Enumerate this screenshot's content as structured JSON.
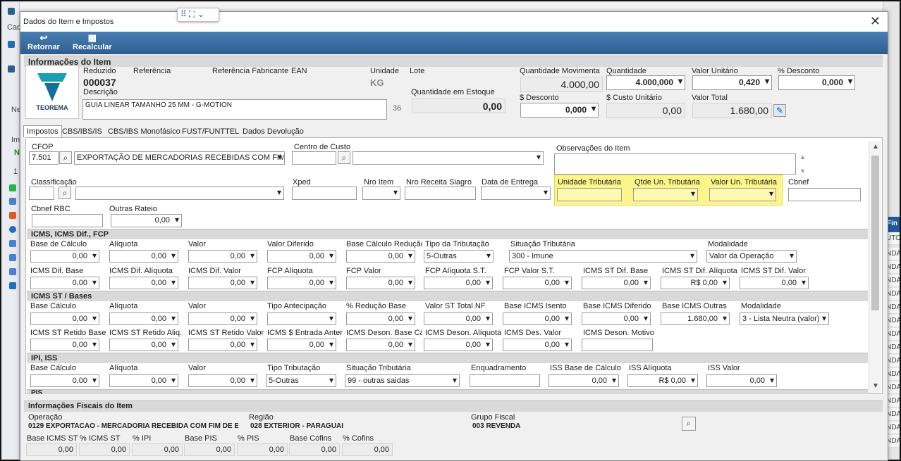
{
  "background": {
    "left_texts": [
      "Cad",
      "Ne",
      "Im",
      "N",
      "1"
    ],
    "right_header": "Fin",
    "right_cells": [
      "UTO",
      "NDA",
      "NDA",
      "NDA",
      "NDA",
      "NDA",
      "NDA",
      "NDA",
      "NDA",
      "NDA",
      "NDA",
      "NDA",
      "NDA",
      "NDA",
      "NDA",
      "NDA"
    ]
  },
  "dialog": {
    "title": "Dados do Item e Impostos"
  },
  "toolbar": {
    "retornar": "Retornar",
    "recalcular": "Recalcular"
  },
  "item_info": {
    "section_title": "Informações do Item",
    "logo_text": "TEOREMA",
    "reduzido_label": "Reduzido",
    "reduzido_value": "000037",
    "referencia_label": "Referência",
    "ref_fabricante_label": "Referência Fabricante",
    "ean_label": "EAN",
    "unidade_label": "Unidade",
    "unidade_value": "KG",
    "lote_label": "Lote",
    "descricao_label": "Descrição",
    "descricao_value": "GUIA LINEAR TAMANHO 25 MM - G-MOTION",
    "descricao_num": "36",
    "qtd_estoque_label": "Quantidade em Estoque",
    "qtd_estoque_value": "0,00",
    "qtd_movimenta_label": "Quantidade Movimenta",
    "qtd_movimenta_value": "4.000,00",
    "quantidade_label": "Quantidade",
    "quantidade_value": "4.000,000",
    "valor_unitario_label": "Valor Unitário",
    "valor_unitario_value": "0,420",
    "desconto_pct_label": "% Desconto",
    "desconto_pct_value": "0,000",
    "desconto_label": "$ Desconto",
    "desconto_value": "0,000",
    "custo_unitario_label": "$ Custo Unitário",
    "custo_unitario_value": "0,00",
    "valor_total_label": "Valor Total",
    "valor_total_value": "1.680,00"
  },
  "tabs": [
    "Impostos",
    "CBS/IBS/IS",
    "CBS/IBS Monofásico",
    "FUST/FUNTTEL",
    "Dados Devolução"
  ],
  "top_fields": {
    "cfop_label": "CFOP",
    "cfop_code": "7.501",
    "cfop_desc": "EXPORTAÇÃO DE MERCADORIAS RECEBIDAS COM FIM E",
    "centro_custo_label": "Centro de Custo",
    "obs_label": "Observações do Item",
    "classificacao_label": "Classificação",
    "xped_label": "Xped",
    "nro_item_label": "Nro Item",
    "nro_receita_label": "Nro Receita Siagro",
    "data_entrega_label": "Data de Entrega",
    "unidade_trib_label": "Unidade Tributária",
    "qtde_un_trib_label": "Qtde Un. Tributária",
    "valor_un_trib_label": "Valor Un. Tributária",
    "cbnef_label": "Cbnef",
    "cbnef_rbc_label": "Cbnef RBC",
    "outras_rateio_label": "Outras Rateio",
    "outras_rateio_value": "0,00"
  },
  "icms": {
    "title": "ICMS, ICMS Dif., FCP",
    "row1_labels": [
      "Base de Cálculo",
      "Alíquota",
      "Valor",
      "Valor Diferido",
      "Base Cálculo Redução",
      "Tipo da Tributação",
      "Situação Tributária",
      "Modalidade"
    ],
    "row1_values": [
      "0,00",
      "0,00",
      "0,00",
      "0,00",
      "0,00"
    ],
    "tipo_tributacao": "5-Outras",
    "situacao": "300 - Imune",
    "modalidade": "Valor da Operação",
    "row2_labels": [
      "ICMS Dif. Base",
      "ICMS Dif. Alíquota",
      "ICMS Dif. Valor",
      "FCP Alíquota",
      "FCP Valor",
      "FCP Alíquota S.T.",
      "FCP Valor S.T.",
      "ICMS ST Dif. Base",
      "ICMS ST Dif. Alíquota",
      "ICMS ST Dif. Valor"
    ],
    "row2_values": [
      "0,00",
      "0,00",
      "0,00",
      "0,00",
      "0,00",
      "0,00",
      "0,00",
      "0,00",
      "R$ 0,00",
      "0,00"
    ]
  },
  "icms_st": {
    "title": "ICMS ST / Bases",
    "row1_labels": [
      "Base Cálculo",
      "Alíquota",
      "Valor",
      "Tipo Antecipação",
      "% Redução Base",
      "Valor ST Total NF",
      "Base ICMS Isento",
      "Base ICMS Diferido",
      "Base ICMS Outras",
      "Modalidade"
    ],
    "row1_values": [
      "0,00",
      "0,00",
      "0,00",
      "",
      "0,00",
      "0,00",
      "0,00",
      "0,00",
      "1.680,00"
    ],
    "modalidade": "3 - Lista Neutra (valor)",
    "row2_labels": [
      "ICMS ST Retido Base",
      "ICMS ST Retido Aliq.",
      "ICMS ST Retido Valor",
      "ICMS $ Entrada Anter",
      "ICMS Deson. Base Cál",
      "ICMS Deson. Alíquota",
      "ICMS Des. Valor",
      "ICMS Deson. Motivo"
    ],
    "row2_values": [
      "0,00",
      "0,00",
      "0,00",
      "0,00",
      "0,00",
      "0,00",
      "0,00"
    ]
  },
  "ipi_iss": {
    "title": "IPI, ISS",
    "labels": [
      "Base Cálculo",
      "Alíquota",
      "Valor",
      "Tipo Tributação",
      "Situação Tributária",
      "Enquadramento",
      "ISS Base de Cálculo",
      "ISS Alíquota",
      "ISS Valor"
    ],
    "values": [
      "0,00",
      "0,00",
      "0,00"
    ],
    "tipo_tributacao": "5-Outras",
    "situacao": "99 - outras saidas",
    "iss_base": "0,00",
    "iss_aliquota": "R$ 0,00",
    "iss_valor": "0,00",
    "next_title": "PIS"
  },
  "fiscal": {
    "title": "Informações Fiscais do Item",
    "operacao_label": "Operação",
    "operacao_value": "0129  EXPORTACAO - MERCADORIA RECEBIDA COM FIM DE E",
    "regiao_label": "Região",
    "regiao_value": "028   EXTERIOR - PARAGUAI",
    "grupo_label": "Grupo Fiscal",
    "grupo_value": "003   REVENDA",
    "bottom_labels": [
      "Base ICMS ST",
      "% ICMS ST",
      "% IPI",
      "Base PIS",
      "% PIS",
      "Base Cofins",
      "% Cofins"
    ],
    "bottom_values": [
      "0,00",
      "0,00",
      "0,00",
      "0,00",
      "0,00",
      "0,00",
      "0,00"
    ]
  },
  "colors": {
    "toolbar": "#2d5d8f",
    "yellow_highlight": "#fbf58a",
    "logo_teal": "#1a9fb5"
  }
}
